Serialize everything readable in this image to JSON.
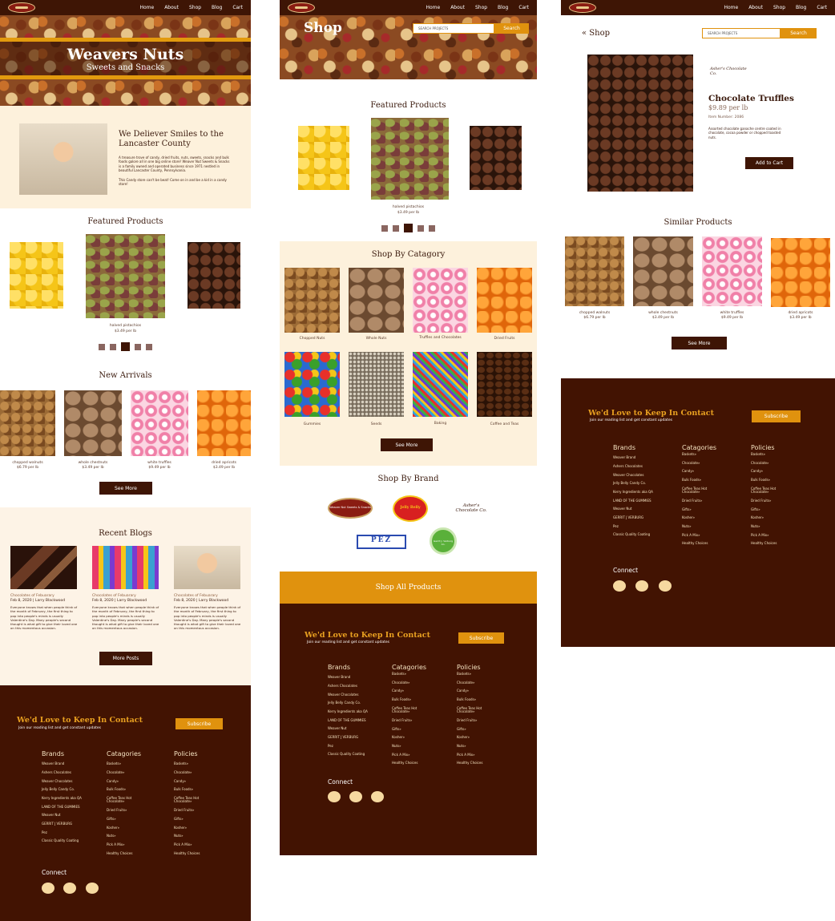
{
  "nav": {
    "home": "Home",
    "about": "About",
    "shop": "Shop",
    "blog": "Blog",
    "cart": "Cart"
  },
  "home": {
    "hero_title": "Weavers Nuts",
    "hero_subtitle": "Sweets and Snacks",
    "intro_title": "We Deliever Smiles to the Lancaster County",
    "intro_p1": "A treasure trove of candy, dried fruits, nuts, sweets, snacks and bulk foods galore all in one big online store! Weaver Nut Sweets & Snacks is a family owned and operated business since 1971 nestled in beautiful Lancaster County, Pennsylvania.",
    "intro_p2": "This Candy store can't be beat!  Come on in and be a kid in a candy store!",
    "featured_title": "Featured Products",
    "featured_name": "halved pistachios",
    "featured_price": "$3.49 per lb",
    "arrivals_title": "New Arrivals",
    "arrivals": [
      {
        "name": "chopped walnuts",
        "price": "$6.79 per lb"
      },
      {
        "name": "whole chestnuts",
        "price": "$3.49 per lb"
      },
      {
        "name": "white truffles",
        "price": "$9.49 per lb"
      },
      {
        "name": "dried apricots",
        "price": "$3.49 per lb"
      }
    ],
    "see_more": "See More",
    "blogs_title": "Recent Blogs",
    "blogs": [
      {
        "title": "Chocolates of Febuarary",
        "meta": "Feb 8, 2020 | Larry Blackwood",
        "body": "Everyone knows that when people think of the month of February, the first thing to pop into people's minds is usually Valentine's Day. Many people's second thought is what gift to give their loved one on this momentous occasion."
      },
      {
        "title": "Chocolates of Febuarary",
        "meta": "Feb 8, 2020 | Larry Blackwood",
        "body": "Everyone knows that when people think of the month of February, the first thing to pop into people's minds is usually Valentine's Day. Many people's second thought is what gift to give their loved one on this momentous occasion."
      },
      {
        "title": "Chocolates of Febuarary",
        "meta": "Feb 8, 2020 | Larry Blackwood",
        "body": "Everyone knows that when people think of the month of February, the first thing to pop into people's minds is usually Valentine's Day. Many people's second thought is what gift to give their loved one on this momentous occasion."
      }
    ],
    "more_posts": "More Posts"
  },
  "shop": {
    "hero_title": "Shop",
    "search_placeholder": "SEARCH PROJECTS",
    "search_button": "Search",
    "featured_title": "Featured Products",
    "featured_name": "halved pistachios",
    "featured_price": "$3.49 per lb",
    "category_title": "Shop By Catagory",
    "categories": [
      "Chopped Nuts",
      "Whole Nuts",
      "Truffles and Chocolates",
      "Dried Fruits",
      "Gummies",
      "Seeds",
      "Baking",
      "Coffee and Teas"
    ],
    "see_more": "See More",
    "brand_title": "Shop By Brand",
    "brand_logos": [
      "Weaver Nut Sweets & Snacks",
      "Jelly Belly",
      "Asher's Chocolate Co.",
      "PEZ",
      "Gerrit J. Verburg Co."
    ],
    "shop_all": "Shop All Products"
  },
  "product": {
    "back": "« Shop",
    "search_placeholder": "SEARCH PROJECTS",
    "search_button": "Search",
    "brand": "Asher's Chocolate Co.",
    "name": "Chocolate Truffles",
    "price": "$9.89 per lb",
    "item_number": "Item Number: 2086",
    "description": "Assorted chocolate ganache centre coated in chocolate, cocoa powder or chopped toasted nuts.",
    "add_to_cart": "Add to Cart",
    "similar_title": "Similar Products",
    "similar": [
      {
        "name": "chopped walnuts",
        "price": "$6.79 per lb"
      },
      {
        "name": "whole chestnuts",
        "price": "$3.49 per lb"
      },
      {
        "name": "white truffles",
        "price": "$9.49 per lb"
      },
      {
        "name": "dried apricots",
        "price": "$3.49 per lb"
      }
    ],
    "see_more": "See More"
  },
  "footer": {
    "title": "We'd Love to Keep In Contact",
    "subtitle": "Join our reading list and get constant updates",
    "subscribe": "Subscribe",
    "brands_h": "Brands",
    "categories_h": "Catagories",
    "policies_h": "Policies",
    "brands": [
      "Weaver Brand",
      "Ashers Chocolates",
      "Weaver Chocolates",
      "Jelly Belly Candy Co.",
      "Kerry Ingredients aka QA",
      "LAND OF THE GUMMIES",
      "Weaver Nut",
      "GERRIT J VERBURG",
      "Pez",
      "Classic Quality Coating"
    ],
    "categories": [
      "Baskets»",
      "Chocolate»",
      "Candy»",
      "Bulk Foods»",
      "Coffee Teas Hot Chocolate»",
      "Dried Fruits»",
      "Gifts»",
      "Kosher»",
      "Nuts»",
      "Pick A Mix»",
      "Healthy Choices"
    ],
    "policies": [
      "Baskets»",
      "Chocolate»",
      "Candy»",
      "Bulk Foods»",
      "Coffee Teas Hot Chocolate»",
      "Dried Fruits»",
      "Gifts»",
      "Kosher»",
      "Nuts»",
      "Pick A Mix»",
      "Healthy Choices"
    ],
    "connect": "Connect"
  },
  "colors": {
    "brown": "#3e1505",
    "orange": "#e0920e",
    "cream": "#fdf1dc"
  }
}
